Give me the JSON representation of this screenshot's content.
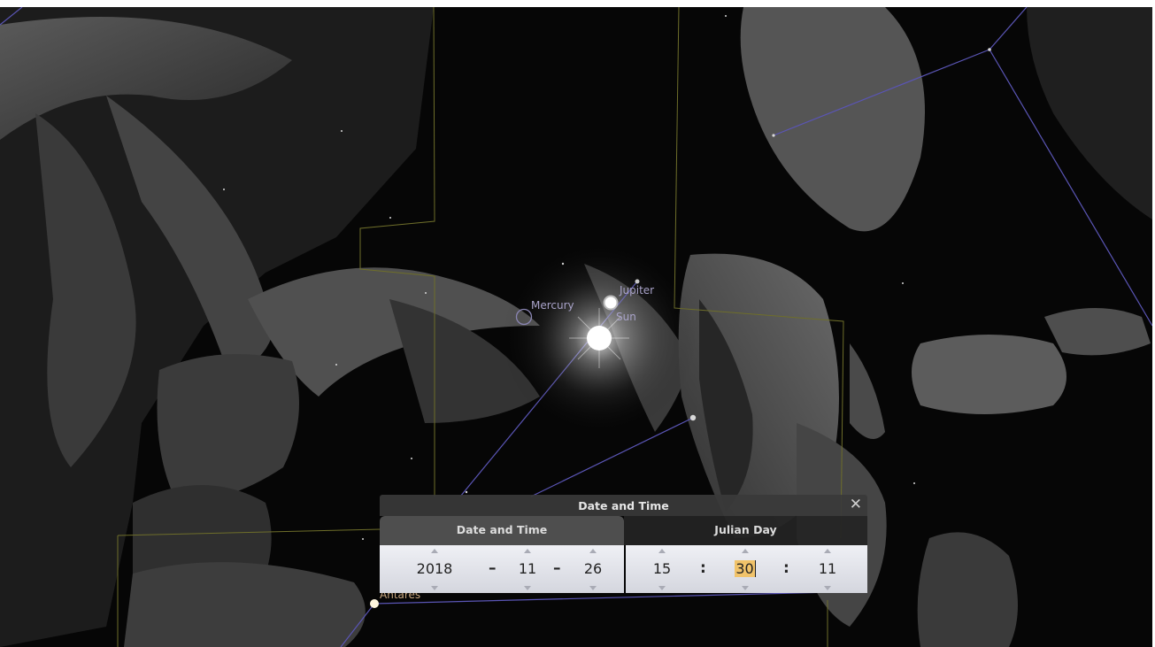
{
  "sky": {
    "labels": {
      "mercury": "Mercury",
      "jupiter": "Jupiter",
      "sun": "Sun",
      "antares": "Antares"
    },
    "colors": {
      "background": "#060606",
      "constellation_line": "#5a55b5",
      "boundary_line": "#6e6e2a",
      "planet_label": "#a9a3c9"
    }
  },
  "dialog": {
    "title": "Date and Time",
    "close_icon": "close-icon",
    "tabs": [
      "Date and Time",
      "Julian Day"
    ],
    "active_tab": "Date and Time",
    "date": {
      "year": "2018",
      "month": "11",
      "day": "26",
      "separator": "–"
    },
    "time": {
      "hour": "15",
      "minute": "30",
      "second": "11",
      "separator": ":"
    },
    "selected_field": "minute",
    "highlight_color": "#f1c36a"
  }
}
